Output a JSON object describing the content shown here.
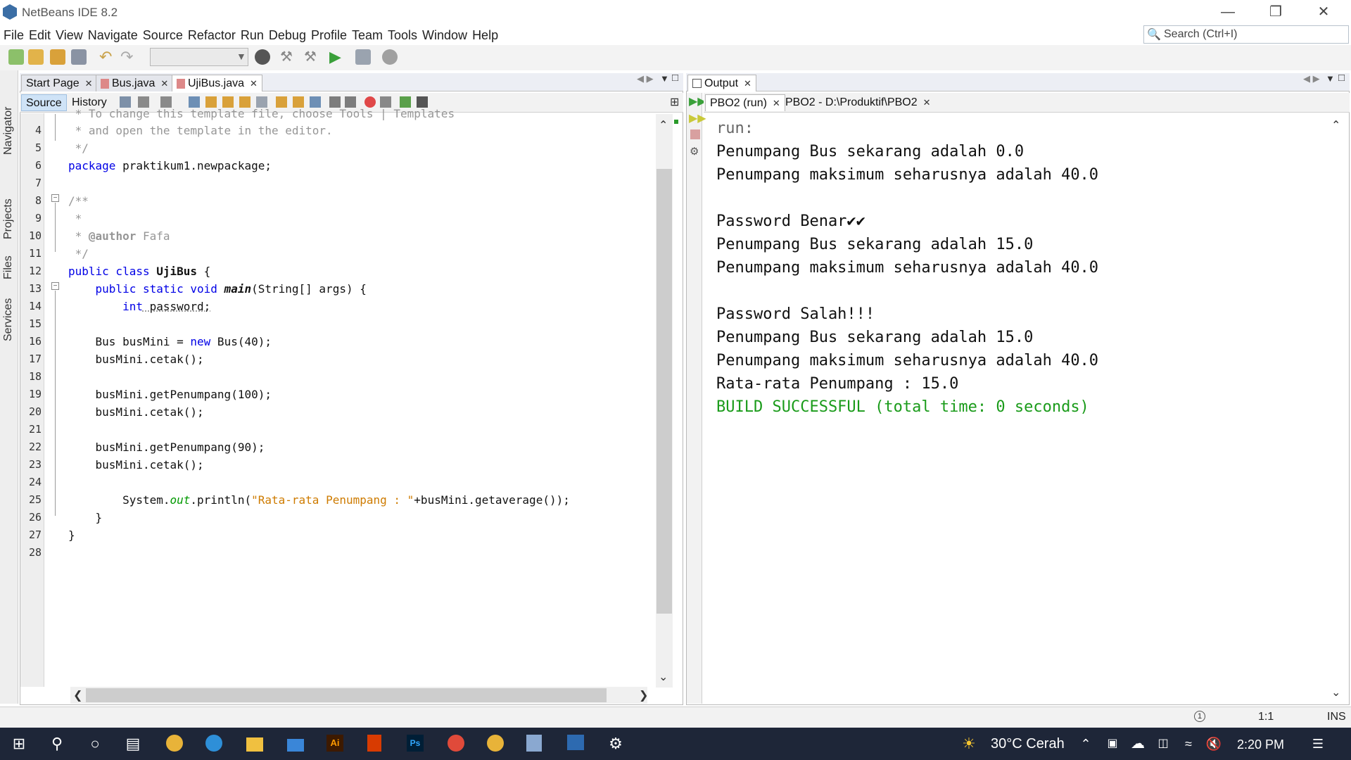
{
  "window": {
    "title": "NetBeans IDE 8.2",
    "minimize_icon": "minimize-icon",
    "restore_icon": "restore-icon",
    "close_icon": "close-icon"
  },
  "menu": [
    "File",
    "Edit",
    "View",
    "Navigate",
    "Source",
    "Refactor",
    "Run",
    "Debug",
    "Profile",
    "Team",
    "Tools",
    "Window",
    "Help"
  ],
  "search": {
    "placeholder": "Search (Ctrl+I)"
  },
  "side_tabs": [
    "Navigator",
    "Projects",
    "Files",
    "Services"
  ],
  "editor": {
    "tabs": [
      {
        "label": "Start Page",
        "active": false
      },
      {
        "label": "Bus.java",
        "active": false
      },
      {
        "label": "UjiBus.java",
        "active": true
      }
    ],
    "view_tabs": [
      "Source",
      "History"
    ],
    "line_numbers": [
      "4",
      "5",
      "6",
      "7",
      "8",
      "9",
      "10",
      "11",
      "12",
      "13",
      "14",
      "15",
      "16",
      "17",
      "18",
      "19",
      "20",
      "21",
      "22",
      "23",
      "24",
      "25",
      "26",
      "27",
      "28"
    ],
    "code": {
      "l3": " * To change this template file, choose Tools | Templates",
      "l4": " * and open the template in the editor.",
      "l5": " */",
      "l6a": "package",
      "l6b": " praktikum1.newpackage;",
      "l8": "/**",
      "l9": " *",
      "l10a": " * ",
      "l10b": "@author",
      "l10c": " Fafa",
      "l11": " */",
      "l12a": "public class",
      "l12b": " UjiBus",
      "l12c": " {",
      "l13a": "    public static void",
      "l13b": " main",
      "l13c": "(String[] args) {",
      "l14a": "        int",
      "l14b": " password;",
      "l16a": "    Bus busMini = ",
      "l16b": "new",
      "l16c": " Bus(40);",
      "l17": "    busMini.cetak();",
      "l19": "    busMini.getPenumpang(100);",
      "l20": "    busMini.cetak();",
      "l22": "    busMini.getPenumpang(90);",
      "l23": "    busMini.cetak();",
      "l25a": "        System.",
      "l25b": "out",
      "l25c": ".println(",
      "l25d": "\"Rata-rata Penumpang : \"",
      "l25e": "+busMini.getaverage());",
      "l26": "    }",
      "l27": "}"
    }
  },
  "output": {
    "title": "Output",
    "tabs": [
      {
        "label": "PBO2 (run)",
        "active": true
      },
      {
        "label": "PBO2 - D:\\Produktif\\PBO2",
        "active": false
      }
    ],
    "lines": [
      "run:",
      "Penumpang Bus sekarang adalah 0.0",
      "Penumpang maksimum seharusnya adalah 40.0",
      "",
      "Password Benar✔✔",
      "Penumpang Bus sekarang adalah 15.0",
      "Penumpang maksimum seharusnya adalah 40.0",
      "",
      "Password Salah!!!",
      "Penumpang Bus sekarang adalah 15.0",
      "Penumpang maksimum seharusnya adalah 40.0",
      "Rata-rata Penumpang : 15.0",
      "BUILD SUCCESSFUL (total time: 0 seconds)"
    ]
  },
  "status": {
    "position": "1:1",
    "mode": "INS"
  },
  "taskbar": {
    "weather": "30°C  Cerah",
    "time": "2:20 PM"
  },
  "colors": {
    "keyword": "#0000e6",
    "comment": "#969696",
    "string": "#ce7b00",
    "success": "#1a9b1a",
    "taskbar": "#1e2638"
  }
}
